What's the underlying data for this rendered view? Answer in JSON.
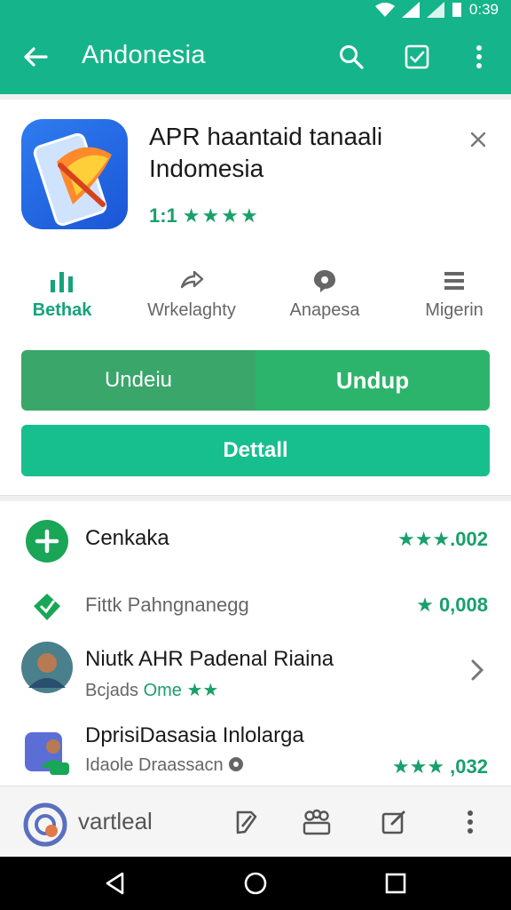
{
  "status_bar": {
    "time": "0:39"
  },
  "app_bar": {
    "title": "Andonesia",
    "accent": "#16b48a"
  },
  "app": {
    "title": "APR haantaid tanaali Indomesia",
    "rating_value": "1:1",
    "rating_stars": "★★★★"
  },
  "metrics": [
    {
      "label": "Bethak"
    },
    {
      "label": "Wrkelaghty"
    },
    {
      "label": "Anapesa"
    },
    {
      "label": "Migerin"
    }
  ],
  "buttons": {
    "split_left": "Undeiu",
    "split_right": "Undup",
    "detail": "Dettall"
  },
  "list": [
    {
      "name": "Cenkaka",
      "right": "★★★.002"
    },
    {
      "name": "Fittk Pahngnanegg",
      "right": "★ 0,008"
    },
    {
      "name": "Niutk AHR Padenal Riaina",
      "sub_prefix": "Bcjads ",
      "sub_green": "Ome ★★"
    },
    {
      "name": "DprisiDasasia Inlolarga",
      "sub_prefix": "Idaole Draassacn",
      "right": "★★★ ,032"
    }
  ],
  "bottom_bar": {
    "brand": "vartleal"
  }
}
